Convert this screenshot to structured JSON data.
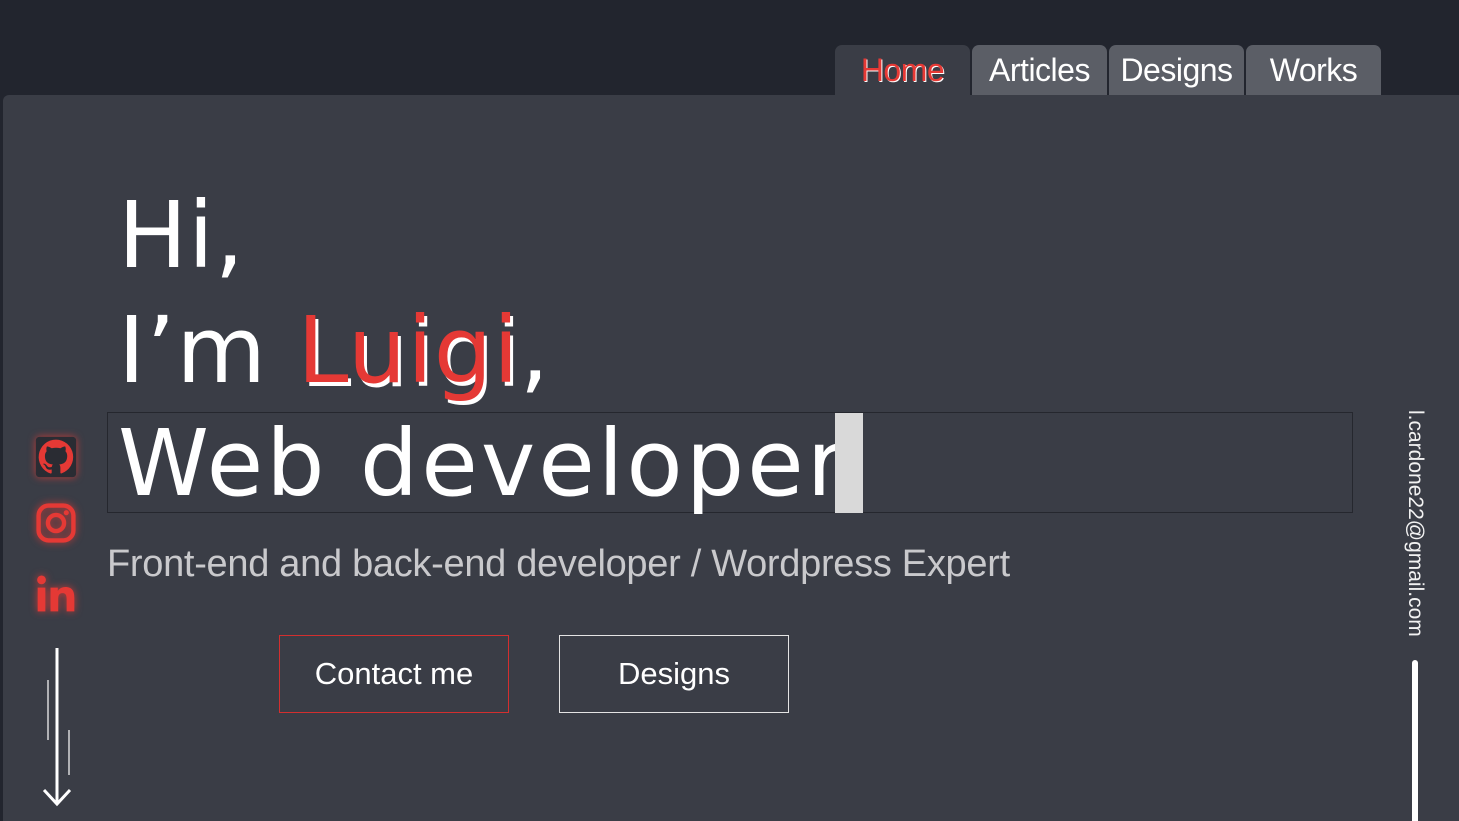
{
  "nav": {
    "tabs": [
      {
        "label": "Home",
        "active": true
      },
      {
        "label": "Articles",
        "active": false
      },
      {
        "label": "Designs",
        "active": false
      },
      {
        "label": "Works",
        "active": false
      }
    ]
  },
  "hero": {
    "line1": "Hi,",
    "line2_prefix": "I’m ",
    "line2_name": "Luigi",
    "line2_suffix": ",",
    "line3": "Web developer",
    "subtitle": "Front-end and back-end developer / Wordpress Expert"
  },
  "buttons": {
    "contact_label": "Contact me",
    "designs_label": "Designs"
  },
  "social": [
    {
      "icon": "github-icon"
    },
    {
      "icon": "instagram-icon"
    },
    {
      "icon": "linkedin-icon"
    }
  ],
  "email": "l.cardone22@gmail.com",
  "colors": {
    "accent": "#e53935",
    "panel": "#3a3d46",
    "background": "#22252e",
    "tab_inactive": "#5b5e66"
  }
}
